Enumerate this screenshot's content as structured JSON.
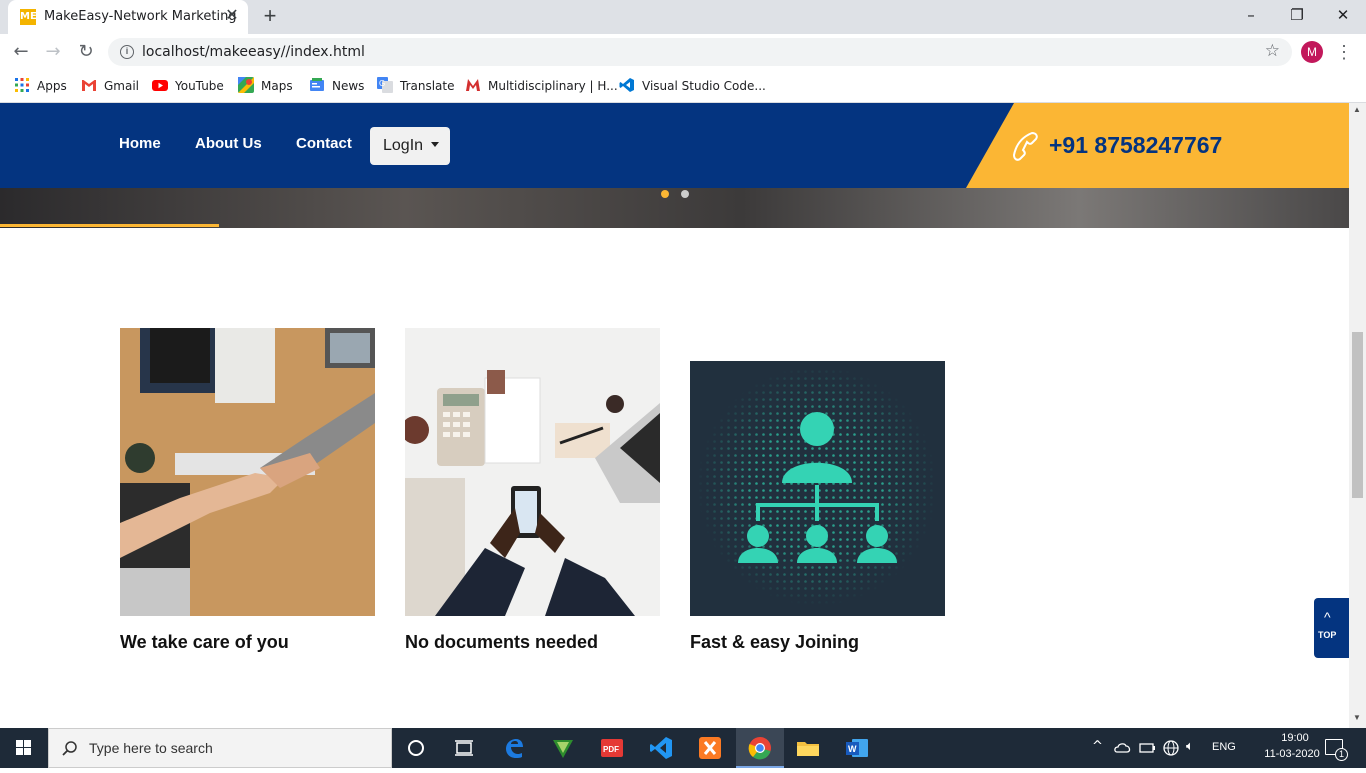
{
  "browser": {
    "tab_title": "MakeEasy-Network Marketing",
    "tab_favicon_text": "ME",
    "url": "localhost/makeeasy//index.html",
    "profile_initial": "M"
  },
  "bookmarks": [
    {
      "label": "Apps",
      "icon": "apps-grid-icon"
    },
    {
      "label": "Gmail",
      "icon": "gmail-icon"
    },
    {
      "label": "YouTube",
      "icon": "youtube-icon"
    },
    {
      "label": "Maps",
      "icon": "maps-icon"
    },
    {
      "label": "News",
      "icon": "news-icon"
    },
    {
      "label": "Translate",
      "icon": "translate-icon"
    },
    {
      "label": "Multidisciplinary | H...",
      "icon": "m-logo-icon"
    },
    {
      "label": "Visual Studio Code...",
      "icon": "vscode-icon"
    }
  ],
  "nav": {
    "home": "Home",
    "about": "About Us",
    "contact": "Contact",
    "login": "LogIn",
    "phone": "+91 8758247767"
  },
  "cards": [
    {
      "title": "We take care of you",
      "image": "handshake-photo"
    },
    {
      "title": "No documents needed",
      "image": "desk-phone-photo"
    },
    {
      "title": "Fast & easy Joining",
      "image": "network-hierarchy-graphic"
    }
  ],
  "top_button": "TOP",
  "taskbar": {
    "search_placeholder": "Type here to search",
    "language": "ENG",
    "time": "19:00",
    "date": "11-03-2020",
    "notification_count": "1"
  },
  "colors": {
    "navy": "#043480",
    "accent": "#fbb634"
  }
}
